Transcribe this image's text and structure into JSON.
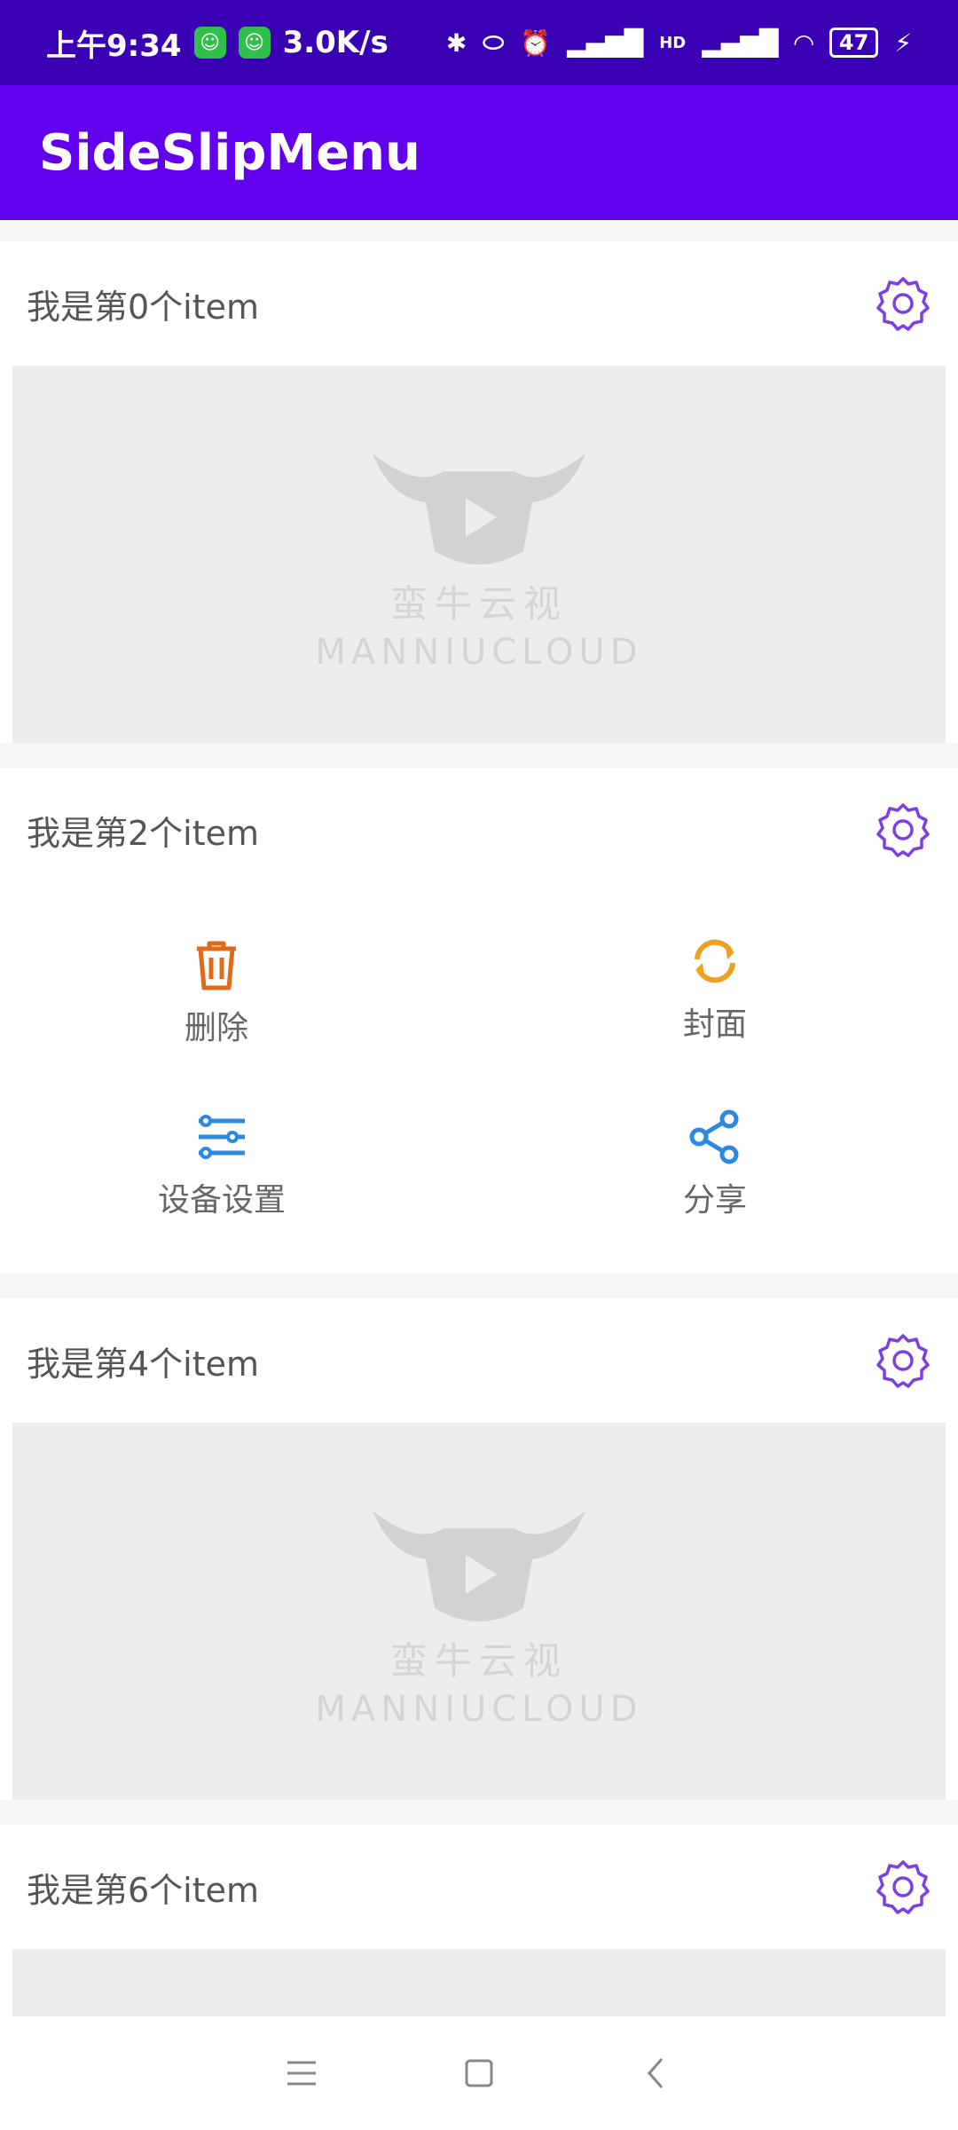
{
  "status_bar": {
    "time": "上午9:34",
    "speed": "3.0K/s",
    "battery": "47",
    "network": "HD"
  },
  "app_bar": {
    "title": "SideSlipMenu"
  },
  "items": [
    {
      "title": "我是第0个item",
      "placeholder_line1": "蛮牛云视",
      "placeholder_line2": "MANNIUCLOUD"
    },
    {
      "title": "我是第2个item"
    },
    {
      "title": "我是第4个item",
      "placeholder_line1": "蛮牛云视",
      "placeholder_line2": "MANNIUCLOUD"
    },
    {
      "title": "我是第6个item"
    }
  ],
  "menu": {
    "delete_label": "删除",
    "cover_label": "封面",
    "settings_label": "设备设置",
    "share_label": "分享"
  },
  "colors": {
    "status_bar": "#3a00b3",
    "app_bar": "#6200ee",
    "gear": "#7b3fe4",
    "delete": "#e06a1a",
    "cover": "#f0a020",
    "settings": "#2b8ae0",
    "share": "#2b8ae0"
  },
  "icons": {
    "gear": "gear-icon",
    "delete": "trash-icon",
    "cover": "refresh-icon",
    "settings": "sliders-icon",
    "share": "share-icon",
    "nav_menu": "menu-icon",
    "nav_home": "square-home-icon",
    "nav_back": "back-chevron-icon"
  }
}
